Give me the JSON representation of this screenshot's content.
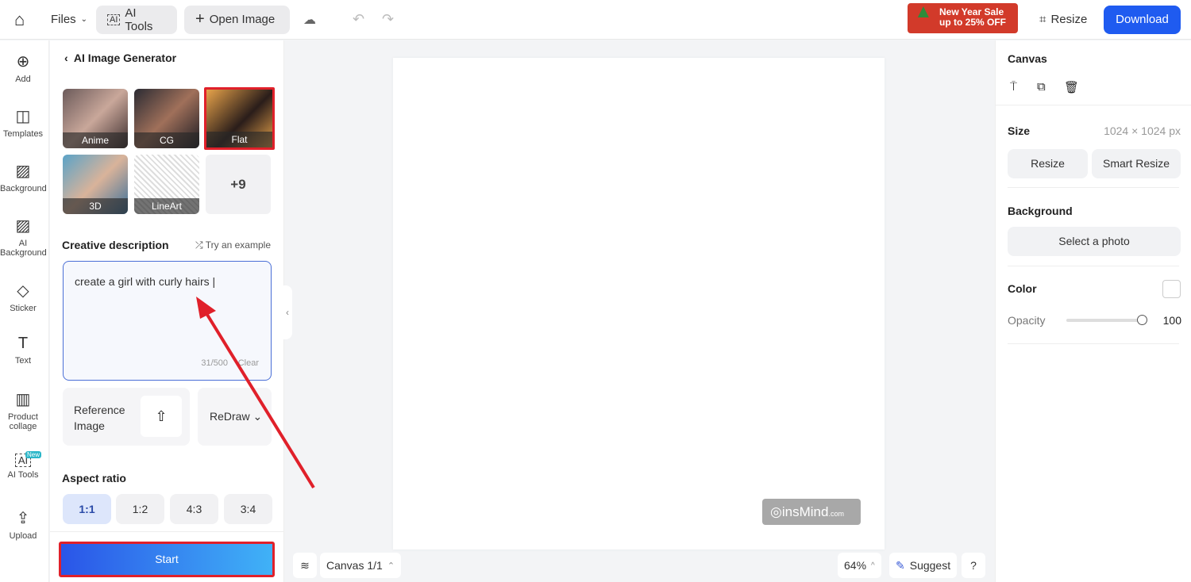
{
  "topbar": {
    "files": "Files",
    "ai_tools": "AI Tools",
    "open_image": "Open Image",
    "promo_line1": "New Year Sale",
    "promo_line2": "up to 25% OFF",
    "resize": "Resize",
    "download": "Download"
  },
  "rail": [
    {
      "label": "Add",
      "icon": "plus-circle"
    },
    {
      "label": "Templates",
      "icon": "templates"
    },
    {
      "label": "Background",
      "icon": "hatch"
    },
    {
      "label": "AI Background",
      "icon": "ai-hatch"
    },
    {
      "label": "Sticker",
      "icon": "sticker"
    },
    {
      "label": "Text",
      "icon": "text-T"
    },
    {
      "label": "Product collage",
      "icon": "book"
    },
    {
      "label": "AI Tools",
      "icon": "ai",
      "badge": "New"
    },
    {
      "label": "Upload",
      "icon": "upload"
    }
  ],
  "panel": {
    "title": "AI Image Generator",
    "styles": [
      "Anime",
      "CG",
      "Flat",
      "3D",
      "LineArt"
    ],
    "more": "+9",
    "selected_style": "Flat",
    "desc_label": "Creative description",
    "try_example": "Try an example",
    "prompt": "create a girl with curly hairs",
    "counter": "31/500",
    "clear": "Clear",
    "reference": "Reference Image",
    "redraw": "ReDraw",
    "aspect_label": "Aspect ratio",
    "ratios": [
      "1:1",
      "1:2",
      "4:3",
      "3:4"
    ],
    "selected_ratio": "1:1",
    "start": "Start"
  },
  "canvas": {
    "watermark": "insMind",
    "watermark_suffix": ".com",
    "page": "Canvas 1/1",
    "zoom": "64%",
    "suggest": "Suggest",
    "help": "?"
  },
  "right": {
    "title": "Canvas",
    "size_label": "Size",
    "size_value": "1024 × 1024 px",
    "resize": "Resize",
    "smart_resize": "Smart Resize",
    "bg_label": "Background",
    "select_photo": "Select a photo",
    "color_label": "Color",
    "opacity_label": "Opacity",
    "opacity": "100"
  },
  "colors": {
    "accent": "#1f5bf0",
    "highlight": "#e0202a"
  }
}
